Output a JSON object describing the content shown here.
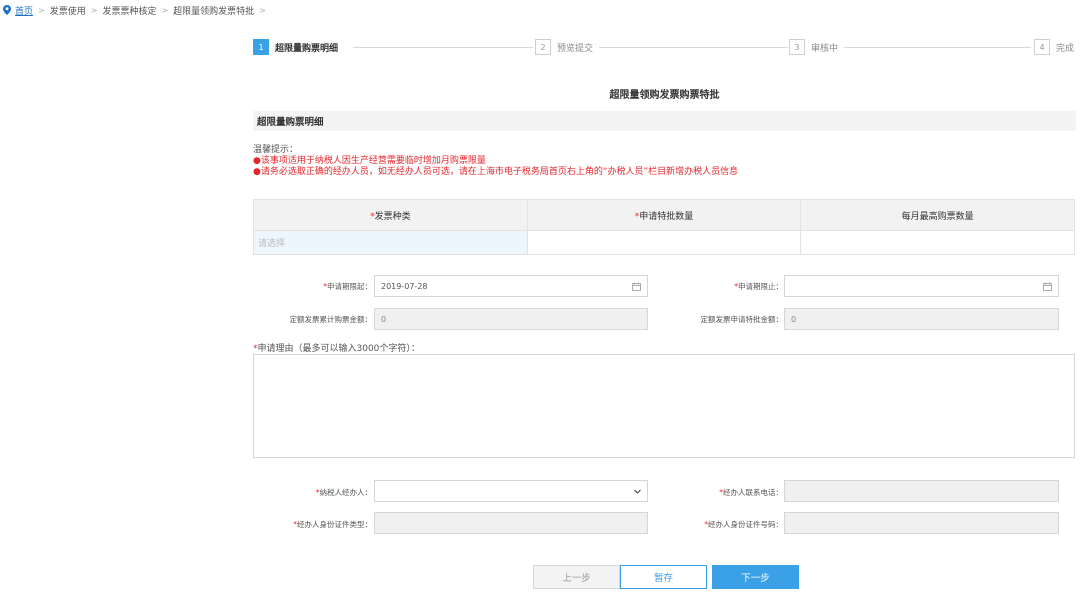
{
  "breadcrumb": {
    "home": "首页",
    "items": [
      "发票使用",
      "发票票种核定",
      "超限量领购发票特批"
    ],
    "separator": ">"
  },
  "steps": [
    {
      "num": "1",
      "label": "超限量购票明细",
      "active": true
    },
    {
      "num": "2",
      "label": "预览提交",
      "active": false
    },
    {
      "num": "3",
      "label": "审核中",
      "active": false
    },
    {
      "num": "4",
      "label": "完成",
      "active": false
    }
  ],
  "page_title": "超限量领购发票购票特批",
  "section_title": "超限量购票明细",
  "tips": {
    "title": "温馨提示：",
    "lines": [
      "●该事项适用于纳税人因生产经营需要临时增加月购票限量",
      "●请务必选取正确的经办人员，如无经办人员可选，请在上海市电子税务局首页右上角的“办税人员”栏目新增办税人员信息"
    ]
  },
  "table": {
    "headers": [
      {
        "required": "*",
        "label": "发票种类"
      },
      {
        "required": "*",
        "label": "申请特批数量"
      },
      {
        "required": "",
        "label": "每月最高购票数量"
      }
    ],
    "row": {
      "select_placeholder": "请选择",
      "qty": "",
      "max": ""
    }
  },
  "form": {
    "start_label": "申请期限起：",
    "start_value": "2019-07-28",
    "end_label": "申请期限止：",
    "end_value": "",
    "total_label": "定额发票累计购票金额：",
    "total_value": "0",
    "special_label": "定额发票申请特批金额：",
    "special_value": "0",
    "reason_label": "申请理由（最多可以输入3000个字符）：",
    "agent_label": "纳税人经办人：",
    "agent_value": "",
    "phone_label": "经办人联系电话：",
    "phone_value": "",
    "idtype_label": "经办人身份证件类型：",
    "idtype_value": "",
    "idno_label": "经办人身份证件号码：",
    "idno_value": "",
    "required_mark": "*"
  },
  "buttons": {
    "prev": "上一步",
    "save": "暂存",
    "next": "下一步"
  },
  "colors": {
    "accent": "#3aa1e6",
    "required": "#e5262c",
    "link": "#1a6fc9"
  }
}
